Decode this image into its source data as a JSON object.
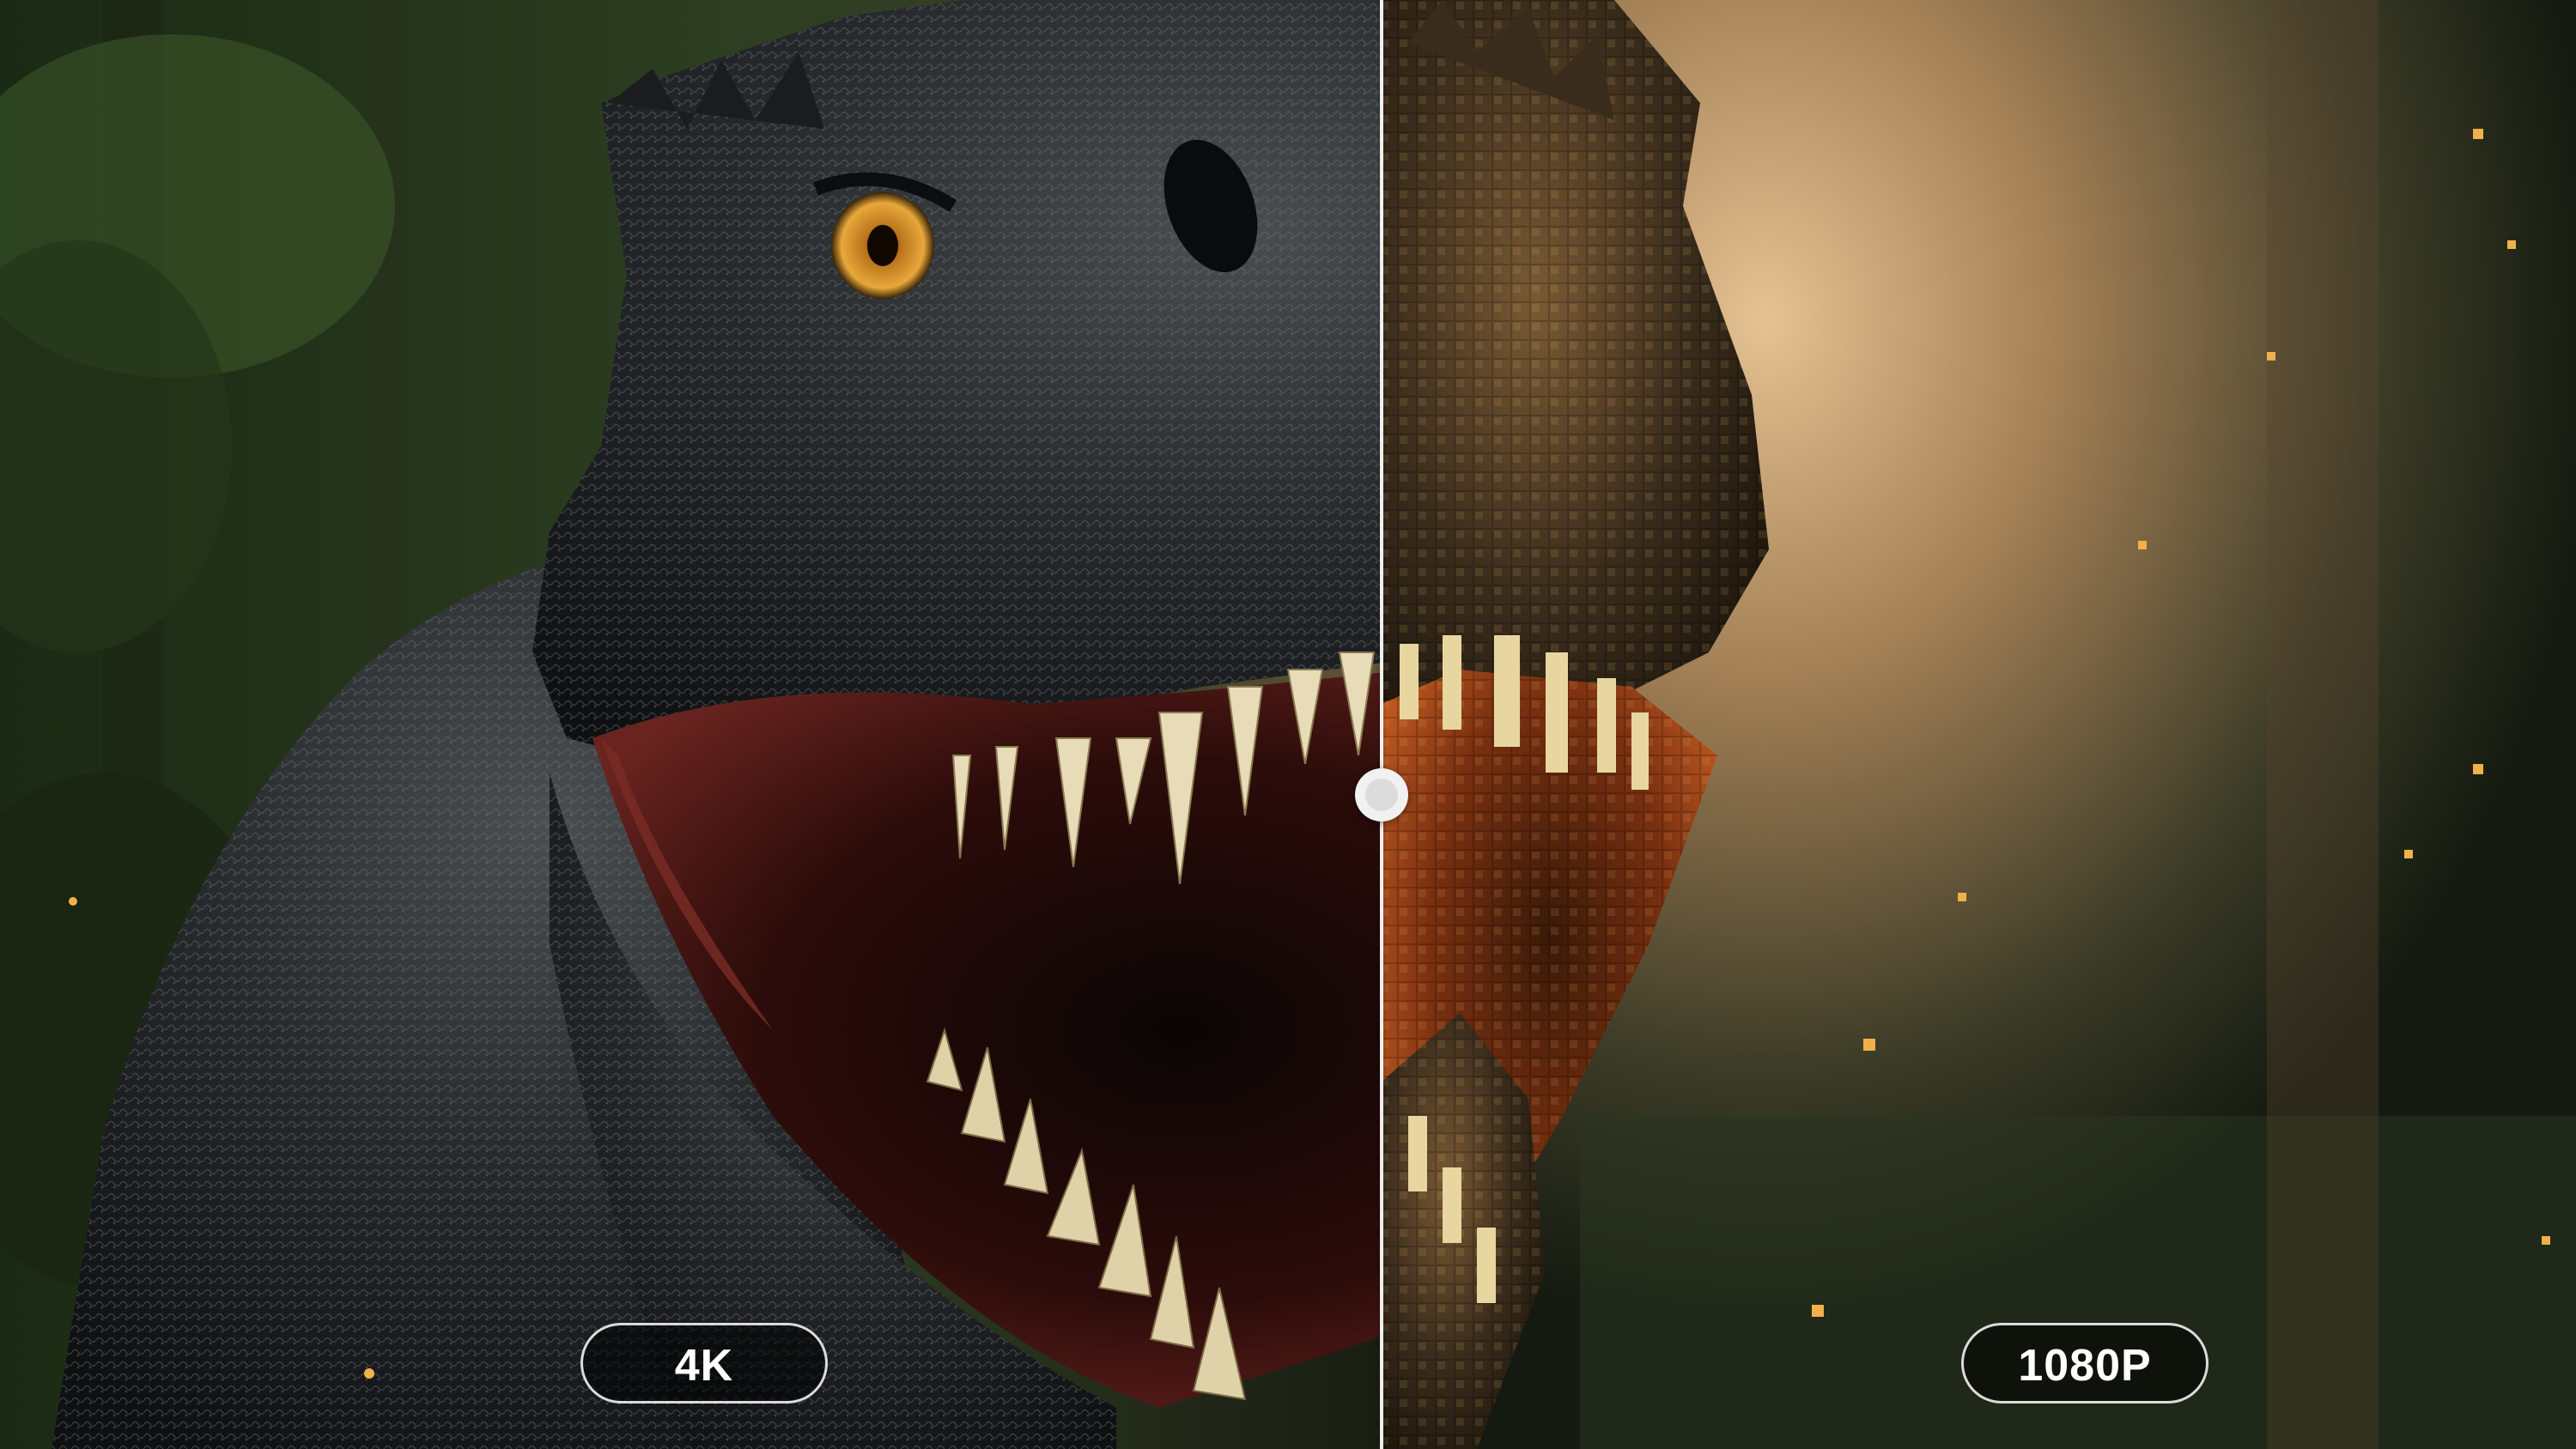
{
  "comparison": {
    "left_label": "4K",
    "right_label": "1080P"
  },
  "colors": {
    "forest_dark": "#10160d",
    "forest_green": "#2a3a22",
    "haze_gold": "#c79a5e",
    "dino_skin": "#22262a",
    "mouth_red": "#5c1c1a",
    "teeth": "#e8dcb8",
    "eye_amber": "#d89a2a",
    "divider": "#ffffff"
  }
}
